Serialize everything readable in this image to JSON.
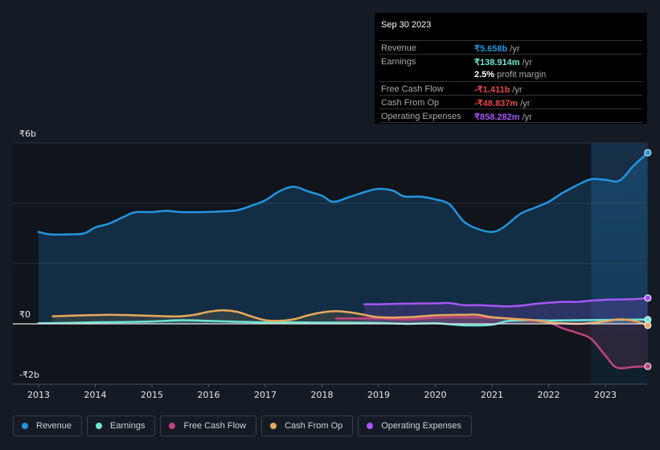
{
  "tooltip": {
    "date": "Sep 30 2023",
    "rows": [
      {
        "label": "Revenue",
        "value": "₹5.658b",
        "unit": " /yr",
        "color": "#2394df"
      },
      {
        "label": "Earnings",
        "value": "₹138.914m",
        "unit": " /yr",
        "color": "#6ee7d4"
      },
      {
        "label": "",
        "value": "2.5%",
        "unit": " profit margin",
        "color": "#ffffff"
      },
      {
        "label": "Free Cash Flow",
        "value": "-₹1.411b",
        "unit": " /yr",
        "color": "#e64545"
      },
      {
        "label": "Cash From Op",
        "value": "-₹48.837m",
        "unit": " /yr",
        "color": "#e64545"
      },
      {
        "label": "Operating Expenses",
        "value": "₹858.282m",
        "unit": " /yr",
        "color": "#a855f7"
      }
    ]
  },
  "legend": [
    {
      "label": "Revenue",
      "color": "#2394df"
    },
    {
      "label": "Earnings",
      "color": "#6ee7d4"
    },
    {
      "label": "Free Cash Flow",
      "color": "#c2427f"
    },
    {
      "label": "Cash From Op",
      "color": "#e8a95c"
    },
    {
      "label": "Operating Expenses",
      "color": "#a855f7"
    }
  ],
  "chart_data": {
    "type": "line",
    "title": "",
    "xlabel": "",
    "ylabel": "",
    "currency": "₹",
    "y_unit": "b",
    "ylim": [
      -2,
      6
    ],
    "y_ticks": [
      {
        "value": 6,
        "label": "₹6b"
      },
      {
        "value": 0,
        "label": "₹0"
      },
      {
        "value": -2,
        "label": "-₹2b"
      }
    ],
    "gridlines": [
      6,
      4,
      2,
      0,
      -2
    ],
    "xlim": [
      2012.55,
      2023.75
    ],
    "x_ticks": [
      "2013",
      "2014",
      "2015",
      "2016",
      "2017",
      "2018",
      "2019",
      "2020",
      "2021",
      "2022",
      "2023"
    ],
    "highlight_range": [
      2022.75,
      2023.75
    ],
    "legend_position": "bottom-left",
    "series": [
      {
        "name": "Revenue",
        "color": "#2394df",
        "fill": true,
        "points": [
          [
            2013.0,
            3.05
          ],
          [
            2013.2,
            2.97
          ],
          [
            2013.5,
            2.97
          ],
          [
            2013.8,
            3.0
          ],
          [
            2014.0,
            3.2
          ],
          [
            2014.25,
            3.33
          ],
          [
            2014.5,
            3.55
          ],
          [
            2014.7,
            3.7
          ],
          [
            2015.0,
            3.71
          ],
          [
            2015.25,
            3.75
          ],
          [
            2015.5,
            3.71
          ],
          [
            2015.9,
            3.71
          ],
          [
            2016.2,
            3.73
          ],
          [
            2016.5,
            3.77
          ],
          [
            2016.8,
            3.95
          ],
          [
            2017.0,
            4.1
          ],
          [
            2017.25,
            4.4
          ],
          [
            2017.5,
            4.55
          ],
          [
            2017.75,
            4.4
          ],
          [
            2018.0,
            4.25
          ],
          [
            2018.2,
            4.05
          ],
          [
            2018.5,
            4.22
          ],
          [
            2018.8,
            4.4
          ],
          [
            2019.0,
            4.48
          ],
          [
            2019.25,
            4.42
          ],
          [
            2019.45,
            4.23
          ],
          [
            2019.75,
            4.22
          ],
          [
            2020.0,
            4.13
          ],
          [
            2020.25,
            3.97
          ],
          [
            2020.5,
            3.4
          ],
          [
            2020.75,
            3.15
          ],
          [
            2021.0,
            3.05
          ],
          [
            2021.2,
            3.2
          ],
          [
            2021.5,
            3.65
          ],
          [
            2021.75,
            3.85
          ],
          [
            2022.0,
            4.05
          ],
          [
            2022.25,
            4.35
          ],
          [
            2022.5,
            4.6
          ],
          [
            2022.75,
            4.8
          ],
          [
            2023.0,
            4.78
          ],
          [
            2023.25,
            4.75
          ],
          [
            2023.5,
            5.25
          ],
          [
            2023.75,
            5.68
          ]
        ]
      },
      {
        "name": "Earnings",
        "color": "#6ee7d4",
        "fill": true,
        "points": [
          [
            2013.0,
            0.02
          ],
          [
            2013.5,
            0.03
          ],
          [
            2014.0,
            0.05
          ],
          [
            2014.5,
            0.06
          ],
          [
            2015.0,
            0.08
          ],
          [
            2015.5,
            0.12
          ],
          [
            2016.0,
            0.1
          ],
          [
            2016.5,
            0.07
          ],
          [
            2017.0,
            0.05
          ],
          [
            2017.5,
            0.05
          ],
          [
            2018.0,
            0.04
          ],
          [
            2018.5,
            0.04
          ],
          [
            2019.0,
            0.03
          ],
          [
            2019.5,
            0.0
          ],
          [
            2020.0,
            0.02
          ],
          [
            2020.5,
            -0.05
          ],
          [
            2021.0,
            -0.03
          ],
          [
            2021.3,
            0.1
          ],
          [
            2021.75,
            0.12
          ],
          [
            2022.0,
            0.11
          ],
          [
            2022.5,
            0.12
          ],
          [
            2023.0,
            0.13
          ],
          [
            2023.5,
            0.14
          ],
          [
            2023.75,
            0.139
          ]
        ]
      },
      {
        "name": "Free Cash Flow",
        "color": "#c2427f",
        "fill": true,
        "points": [
          [
            2018.25,
            0.18
          ],
          [
            2018.75,
            0.18
          ],
          [
            2019.0,
            0.18
          ],
          [
            2019.5,
            0.15
          ],
          [
            2020.0,
            0.2
          ],
          [
            2020.5,
            0.22
          ],
          [
            2021.0,
            0.2
          ],
          [
            2021.5,
            0.15
          ],
          [
            2021.75,
            0.1
          ],
          [
            2022.0,
            0.05
          ],
          [
            2022.25,
            -0.15
          ],
          [
            2022.5,
            -0.3
          ],
          [
            2022.75,
            -0.5
          ],
          [
            2023.0,
            -1.05
          ],
          [
            2023.2,
            -1.45
          ],
          [
            2023.5,
            -1.43
          ],
          [
            2023.75,
            -1.411
          ]
        ]
      },
      {
        "name": "Cash From Op",
        "color": "#e8a95c",
        "fill": true,
        "points": [
          [
            2013.25,
            0.25
          ],
          [
            2013.75,
            0.28
          ],
          [
            2014.25,
            0.3
          ],
          [
            2014.75,
            0.28
          ],
          [
            2015.25,
            0.25
          ],
          [
            2015.5,
            0.25
          ],
          [
            2015.75,
            0.3
          ],
          [
            2016.0,
            0.4
          ],
          [
            2016.25,
            0.45
          ],
          [
            2016.5,
            0.4
          ],
          [
            2016.75,
            0.25
          ],
          [
            2017.0,
            0.12
          ],
          [
            2017.25,
            0.1
          ],
          [
            2017.5,
            0.15
          ],
          [
            2017.75,
            0.28
          ],
          [
            2018.0,
            0.38
          ],
          [
            2018.25,
            0.42
          ],
          [
            2018.5,
            0.38
          ],
          [
            2018.75,
            0.3
          ],
          [
            2019.0,
            0.22
          ],
          [
            2019.5,
            0.22
          ],
          [
            2020.0,
            0.28
          ],
          [
            2020.5,
            0.3
          ],
          [
            2020.75,
            0.3
          ],
          [
            2021.0,
            0.22
          ],
          [
            2021.5,
            0.15
          ],
          [
            2021.75,
            0.12
          ],
          [
            2022.0,
            0.05
          ],
          [
            2022.5,
            0.0
          ],
          [
            2022.75,
            0.03
          ],
          [
            2023.0,
            0.08
          ],
          [
            2023.25,
            0.15
          ],
          [
            2023.5,
            0.1
          ],
          [
            2023.75,
            -0.049
          ]
        ]
      },
      {
        "name": "Operating Expenses",
        "color": "#a855f7",
        "fill": true,
        "points": [
          [
            2018.75,
            0.65
          ],
          [
            2019.0,
            0.65
          ],
          [
            2019.5,
            0.67
          ],
          [
            2020.0,
            0.68
          ],
          [
            2020.25,
            0.69
          ],
          [
            2020.5,
            0.62
          ],
          [
            2020.75,
            0.62
          ],
          [
            2021.0,
            0.6
          ],
          [
            2021.25,
            0.58
          ],
          [
            2021.5,
            0.6
          ],
          [
            2021.75,
            0.66
          ],
          [
            2022.0,
            0.7
          ],
          [
            2022.25,
            0.73
          ],
          [
            2022.5,
            0.73
          ],
          [
            2022.75,
            0.77
          ],
          [
            2023.0,
            0.8
          ],
          [
            2023.5,
            0.82
          ],
          [
            2023.75,
            0.858
          ]
        ]
      }
    ]
  }
}
